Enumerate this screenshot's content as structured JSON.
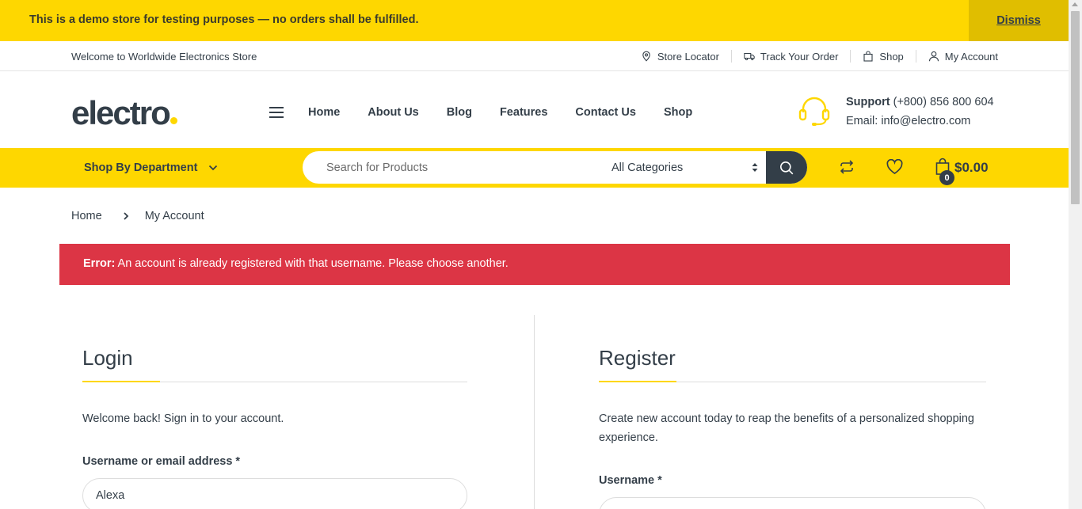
{
  "notice": {
    "text": "This is a demo store for testing purposes — no orders shall be fulfilled.",
    "dismiss_label": "Dismiss"
  },
  "topbar": {
    "welcome": "Welcome to Worldwide Electronics Store",
    "links": [
      {
        "label": "Store Locator",
        "icon": "map-pin-icon"
      },
      {
        "label": "Track Your Order",
        "icon": "truck-icon"
      },
      {
        "label": "Shop",
        "icon": "shopping-bag-icon"
      },
      {
        "label": "My Account",
        "icon": "user-icon"
      }
    ]
  },
  "header": {
    "logo": "electro",
    "nav": [
      "Home",
      "About Us",
      "Blog",
      "Features",
      "Contact Us",
      "Shop"
    ],
    "support_label": "Support",
    "support_phone": "(+800) 856 800 604",
    "email": "Email: info@electro.com"
  },
  "searchbar": {
    "department_label": "Shop By Department",
    "search_placeholder": "Search for Products",
    "category_selected": "All Categories",
    "cart_count": "0",
    "cart_total": "$0.00"
  },
  "breadcrumb": {
    "home": "Home",
    "current": "My Account"
  },
  "error": {
    "prefix": "Error:",
    "message": "An account is already registered with that username. Please choose another."
  },
  "login": {
    "title": "Login",
    "intro": "Welcome back! Sign in to your account.",
    "username_label": "Username or email address *",
    "username_value": "Alexa"
  },
  "register": {
    "title": "Register",
    "intro": "Create new account today to reap the benefits of a personalized shopping experience.",
    "username_label": "Username *",
    "username_value": ""
  },
  "colors": {
    "brand_yellow": "#fed700",
    "dark": "#333e48",
    "error_red": "#dc3545"
  }
}
